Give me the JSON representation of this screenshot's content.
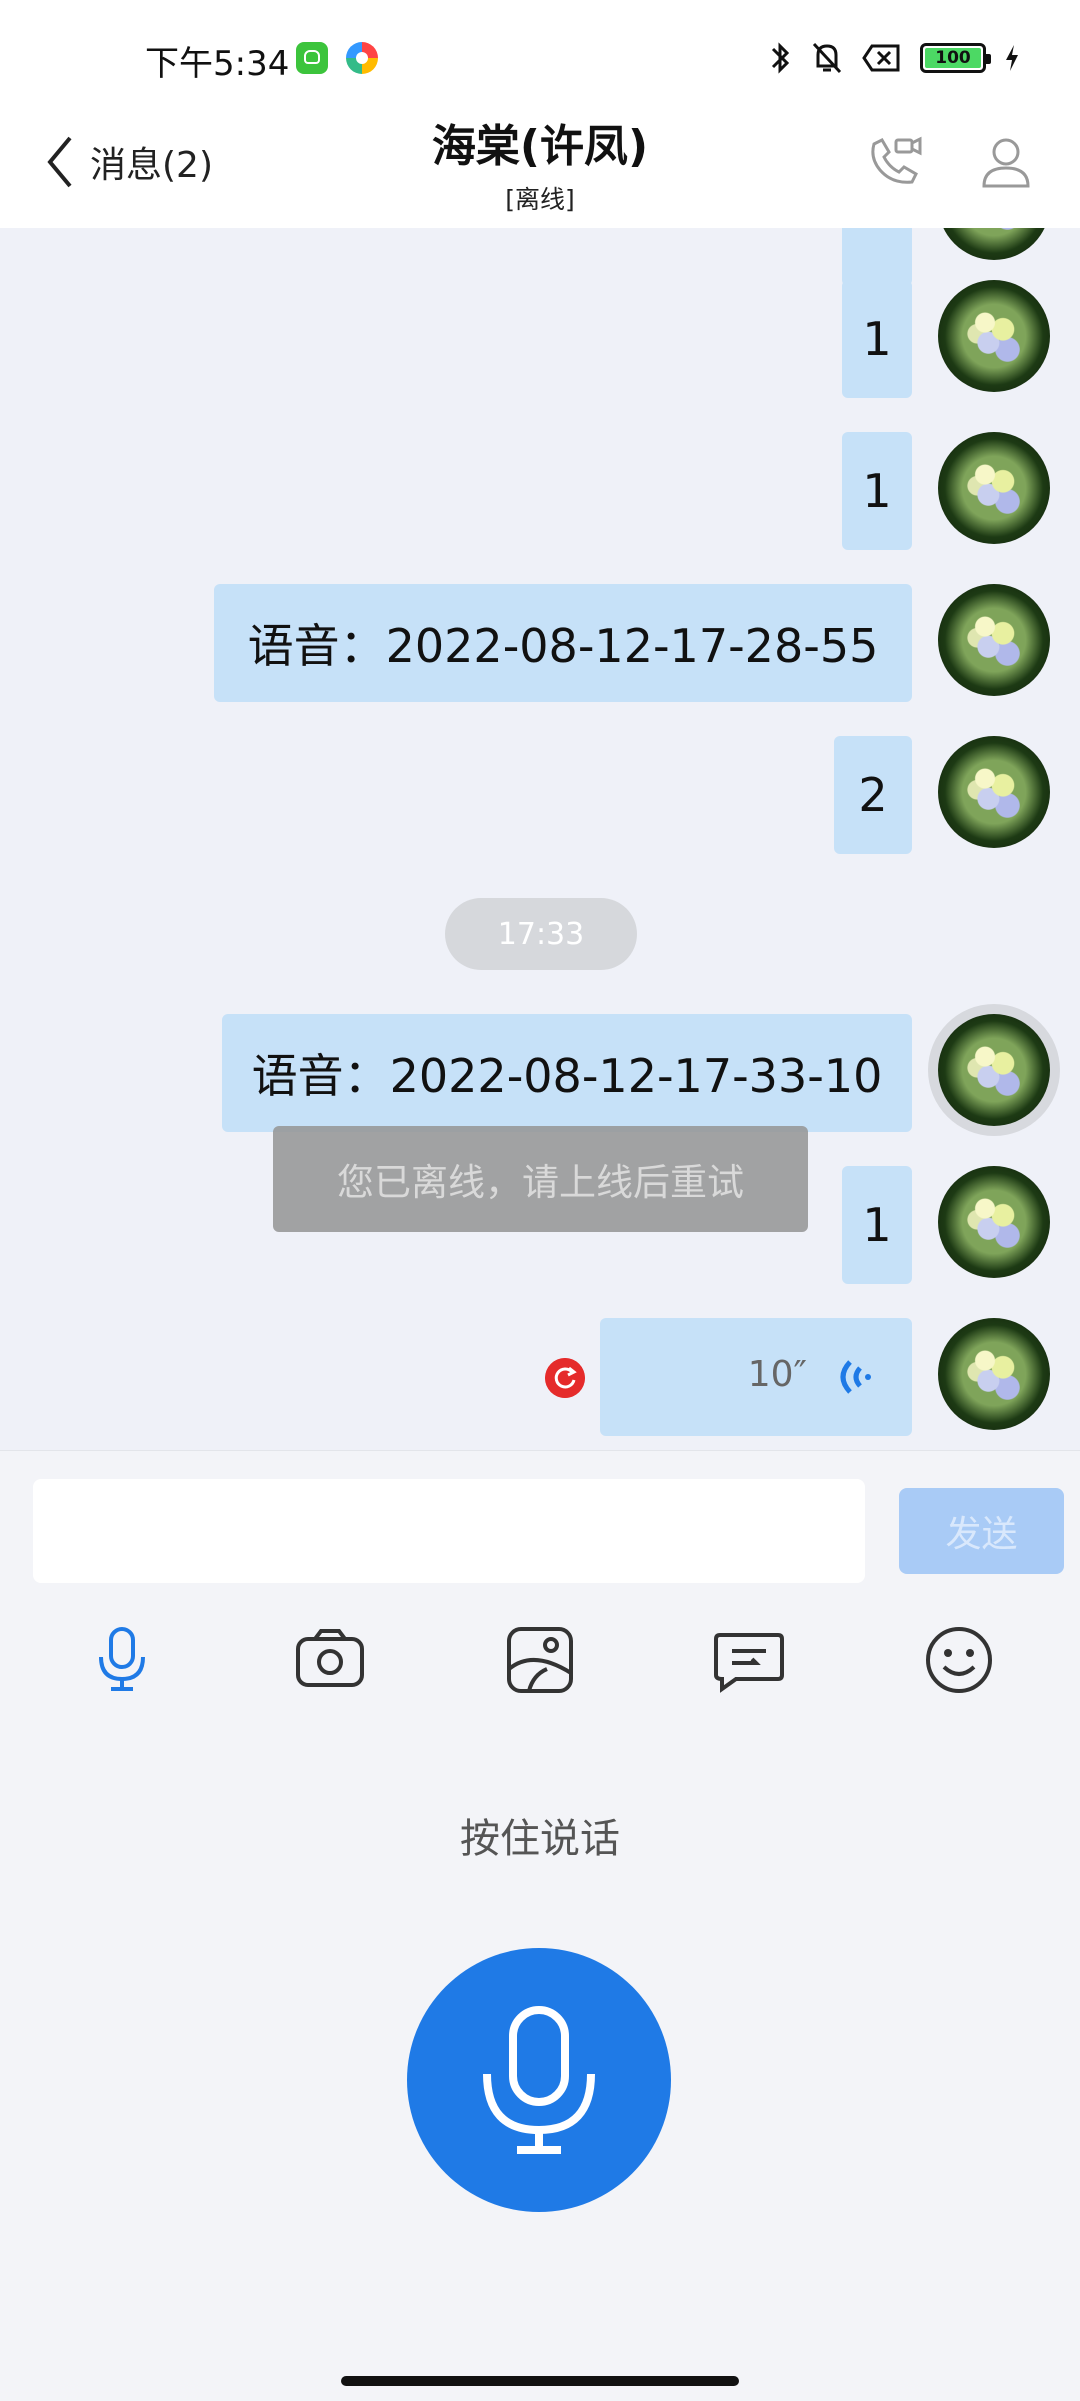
{
  "status_bar": {
    "time": "下午5:34",
    "battery": "100"
  },
  "header": {
    "back_label": "消息(2)",
    "title": "海棠(许凤)",
    "subtitle": "[离线]"
  },
  "chat": {
    "messages": [
      {
        "text": "1"
      },
      {
        "text": "1"
      },
      {
        "text": "语音：2022-08-12-17-28-55"
      },
      {
        "text": "2"
      },
      {
        "text": "语音：2022-08-12-17-33-10"
      },
      {
        "text": "1"
      }
    ],
    "time_divider": "17:33",
    "voice_message": {
      "duration": "10″"
    },
    "toast": "您已离线，请上线后重试"
  },
  "composer": {
    "input_value": "",
    "send_label": "发送",
    "hold_to_talk": "按住说话",
    "tools": [
      "microphone-icon",
      "camera-icon",
      "image-icon",
      "quick-reply-icon",
      "emoji-icon"
    ]
  },
  "colors": {
    "accent": "#1f7ae6",
    "bubble": "#c6e1f8",
    "send_disabled": "#a9cbf6",
    "error": "#e52b2b"
  }
}
